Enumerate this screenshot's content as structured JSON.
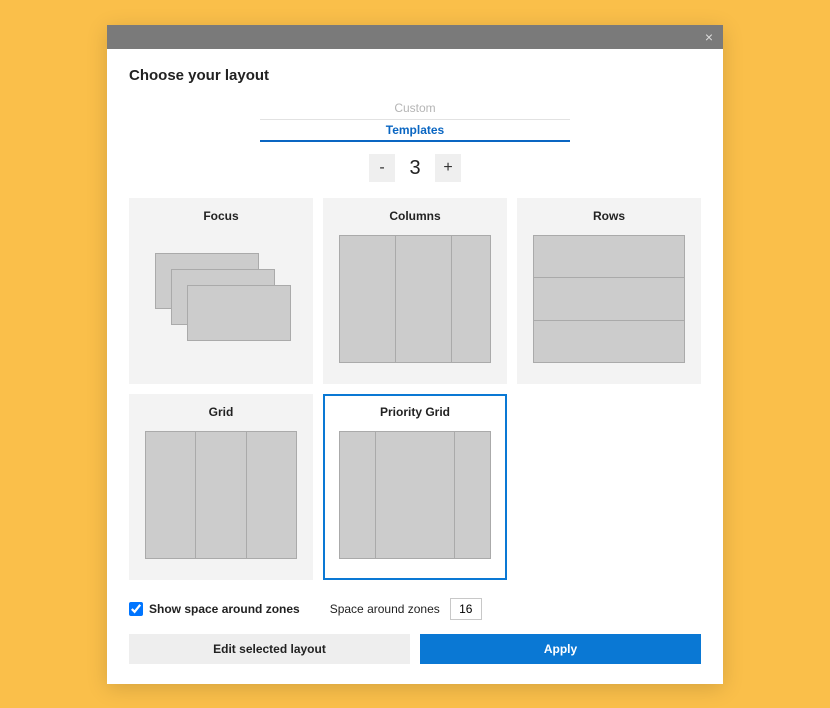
{
  "titlebar": {
    "close_glyph": "×"
  },
  "header": {
    "title": "Choose your layout"
  },
  "tabs": {
    "custom": "Custom",
    "templates": "Templates",
    "active": "templates"
  },
  "stepper": {
    "minus": "-",
    "plus": "+",
    "value": "3"
  },
  "layouts": [
    {
      "id": "focus",
      "label": "Focus"
    },
    {
      "id": "columns",
      "label": "Columns"
    },
    {
      "id": "rows",
      "label": "Rows"
    },
    {
      "id": "grid",
      "label": "Grid"
    },
    {
      "id": "priority",
      "label": "Priority Grid"
    }
  ],
  "selected_layout": "priority",
  "options": {
    "show_space_label": "Show space around zones",
    "show_space_checked": true,
    "space_label": "Space around zones",
    "space_value": "16"
  },
  "buttons": {
    "edit": "Edit selected layout",
    "apply": "Apply"
  }
}
